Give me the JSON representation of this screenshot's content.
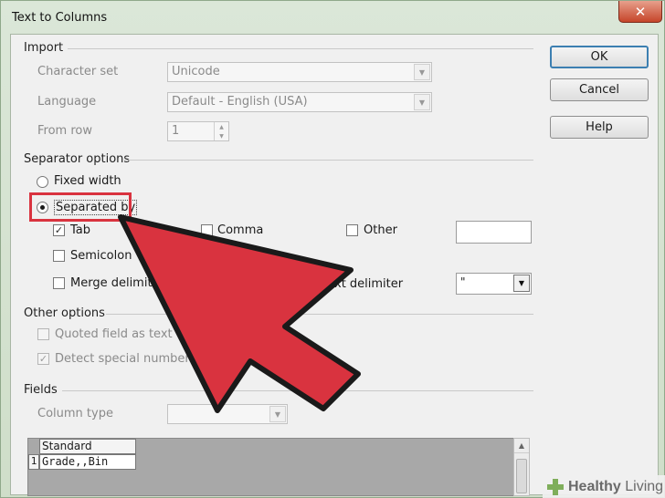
{
  "window": {
    "title": "Text to Columns",
    "close_glyph": "✕"
  },
  "import": {
    "heading": "Import",
    "character_set_label": "Character set",
    "character_set_value": "Unicode",
    "language_label": "Language",
    "language_value": "Default - English (USA)",
    "from_row_label": "From row",
    "from_row_value": "1"
  },
  "separator_options": {
    "heading": "Separator options",
    "fixed_width": "Fixed width",
    "separated_by": "Separated by",
    "tab": "Tab",
    "comma": "Comma",
    "other": "Other",
    "semicolon": "Semicolon",
    "merge_delimiters": "Merge delimite",
    "text_delimiter": "xt delimiter",
    "text_delimiter_value": "\""
  },
  "other_options": {
    "heading": "Other options",
    "quoted_field": "Quoted field as text",
    "detect_special": "Detect special numbers"
  },
  "fields": {
    "heading": "Fields",
    "column_type_label": "Column type",
    "column_type_value": "",
    "preview_header": "Standard",
    "preview_row_number": "1",
    "preview_row_value": "Grade,,Bin"
  },
  "buttons": {
    "ok": "OK",
    "cancel": "Cancel",
    "help": "Help"
  },
  "watermark": {
    "brand_bold": "Healthy",
    "brand_light": " Living"
  },
  "colors": {
    "accent_red": "#d9333f",
    "default_button_border": "#3c7fb1"
  },
  "icons": [
    "close-icon",
    "chevron-down-icon",
    "spin-arrows-icon",
    "checkmark-icon",
    "pointer-arrow-icon",
    "healthy-living-logo-icon"
  ]
}
